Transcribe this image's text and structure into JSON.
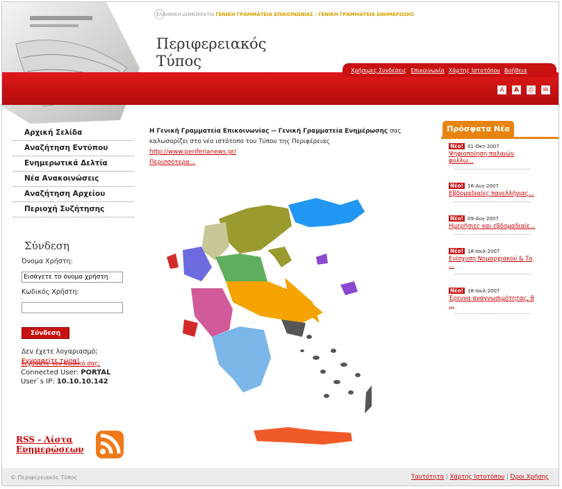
{
  "header": {
    "topline_part1": "ΕΛΛΗΝΙΚΗ ΔΗΜΟΚΡΑΤΙΑ",
    "topline_part2": "ΓΕΝΙΚΗ ΓΡΑΜΜΑΤΕΙΑ ΕΠΙΚΟΙΝΩΝΙΑΣ - ΓΕΝΙΚΗ ΓΡΑΜΜΑΤΕΙΑ ΕΝΗΜΕΡΩΣΗΣ",
    "title_line1": "Περιφερειακός",
    "title_line2": "Τύπος",
    "topnav": [
      "Χρήσιμες Συνδέσεις",
      "Επικοινωνία",
      "Χάρτης Ιστοτόπου",
      "Βοήθεια"
    ],
    "tools": [
      "A",
      "A",
      "print-icon",
      "email-icon"
    ]
  },
  "nav": [
    "Αρχική Σελίδα",
    "Αναζήτηση Εντύπου",
    "Ενημερωτικά Δελτία",
    "Νέα Ανακοινώσεις",
    "Αναζήτηση Αρχείου",
    "Περιοχή Συζήτησης"
  ],
  "login": {
    "title": "Σύνδεση",
    "username_label": "Όνομα Χρήστη:",
    "username_value": "Εισάγετε το όνομα χρήστη",
    "password_label": "Κωδικός Χρήστη:",
    "password_value": "",
    "button": "Σύνδεση",
    "no_account": "Δεν έχετε λογαριασμό;",
    "register": "Εγγραφείτε τώρα!",
    "forgot": "Ξεχάσατε τον Κωδικό σας;",
    "connected_user_label": "Connected User:",
    "connected_user": "PORTAL",
    "ip_label": "User`s IP:",
    "ip": "10.10.10.142"
  },
  "rss": {
    "line1": "RSS - Λίστα",
    "line2": "Ενημερώσεων"
  },
  "intro": {
    "bold": "Η Γενική Γραμματεία Επικοινωνίας -- Γενική Γραμματεία Ενημέρωσης",
    "text": "σας καλωσορίζει στο νέο ιστότοπο του Τύπου της Περιφέρειας",
    "url": "http://www.periferianews.gr/",
    "more": "Περισσότερα..."
  },
  "news": {
    "title": "Πρόσφατα Νέα",
    "badge": "Νέο!",
    "items": [
      {
        "date": "01-Οκτ-2007",
        "title": "Ψηφιοποίηση παλαιών φύλλω..."
      },
      {
        "date": "16-Αυγ-2007",
        "title": "Εβδομαδιαίες πανελλήνιας..."
      },
      {
        "date": "09-Αυγ-2007",
        "title": "Ημερήσιες και εβδομαδιαίε..."
      },
      {
        "date": "18-Ιουλ-2007",
        "title": "Ενίσχυση Νομαρχιακού & Το ..."
      },
      {
        "date": "18-Ιουλ-2007",
        "title": "Έρευνα αναγνωσιμότητας, θ ..."
      }
    ]
  },
  "footer": {
    "copyright": "© Περιφερειακός Τύπος",
    "links": [
      "Ταυτότητα",
      "Χάρτης Ιστοτόπου",
      "Όροι Χρήσης"
    ]
  },
  "colors": {
    "brand_red": "#c81111",
    "accent_orange": "#e88310",
    "link_red": "#cc0000"
  }
}
